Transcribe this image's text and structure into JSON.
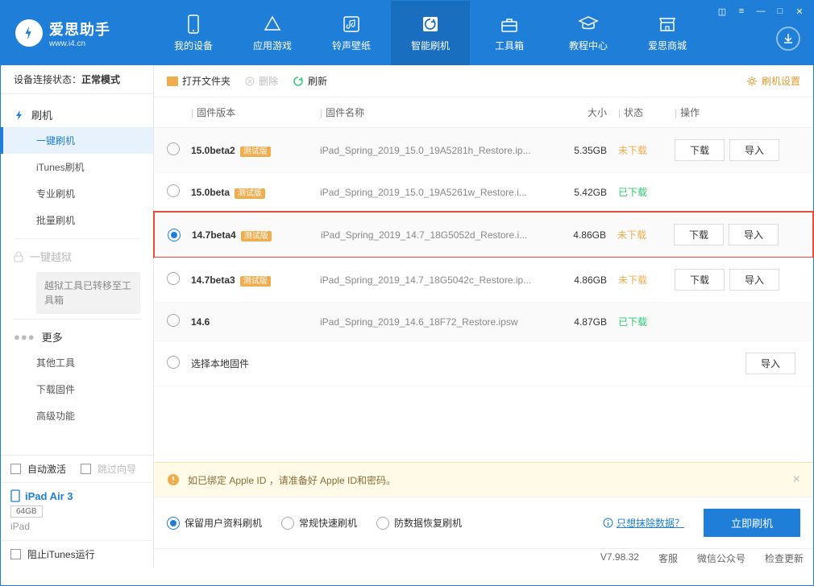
{
  "brand": {
    "title": "爱思助手",
    "subtitle": "www.i4.cn"
  },
  "nav": [
    "我的设备",
    "应用游戏",
    "铃声壁纸",
    "智能刷机",
    "工具箱",
    "教程中心",
    "爱思商城"
  ],
  "connection": {
    "label": "设备连接状态：",
    "value": "正常模式"
  },
  "sidebar": {
    "flash_group": "刷机",
    "flash_items": [
      "一键刷机",
      "iTunes刷机",
      "专业刷机",
      "批量刷机"
    ],
    "jailbreak_group": "一键越狱",
    "jailbreak_note": "越狱工具已转移至工具箱",
    "more_group": "更多",
    "more_items": [
      "其他工具",
      "下载固件",
      "高级功能"
    ],
    "auto_activate": "自动激活",
    "skip_guide": "跳过向导",
    "device": {
      "name": "iPad Air 3",
      "storage": "64GB",
      "type": "iPad"
    },
    "block_itunes": "阻止iTunes运行"
  },
  "toolbar": {
    "open": "打开文件夹",
    "delete": "删除",
    "refresh": "刷新",
    "settings": "刷机设置"
  },
  "columns": {
    "version": "固件版本",
    "name": "固件名称",
    "size": "大小",
    "status": "状态",
    "ops": "操作"
  },
  "status_labels": {
    "not_downloaded": "未下载",
    "downloaded": "已下载"
  },
  "buttons": {
    "download": "下载",
    "import": "导入"
  },
  "firmware": [
    {
      "version": "15.0beta2",
      "beta": "测试版",
      "name": "iPad_Spring_2019_15.0_19A5281h_Restore.ip...",
      "size": "5.35GB",
      "status": "not_downloaded",
      "ops": [
        "download",
        "import"
      ],
      "selected": false,
      "alt": true
    },
    {
      "version": "15.0beta",
      "beta": "测试版",
      "name": "iPad_Spring_2019_15.0_19A5261w_Restore.i...",
      "size": "5.42GB",
      "status": "downloaded",
      "ops": [],
      "selected": false,
      "alt": false
    },
    {
      "version": "14.7beta4",
      "beta": "测试版",
      "name": "iPad_Spring_2019_14.7_18G5052d_Restore.i...",
      "size": "4.86GB",
      "status": "not_downloaded",
      "ops": [
        "download",
        "import"
      ],
      "selected": true,
      "alt": true,
      "highlight": true
    },
    {
      "version": "14.7beta3",
      "beta": "测试版",
      "name": "iPad_Spring_2019_14.7_18G5042c_Restore.ip...",
      "size": "4.86GB",
      "status": "not_downloaded",
      "ops": [
        "download",
        "import"
      ],
      "selected": false,
      "alt": false
    },
    {
      "version": "14.6",
      "beta": "",
      "name": "iPad_Spring_2019_14.6_18F72_Restore.ipsw",
      "size": "4.87GB",
      "status": "downloaded",
      "ops": [],
      "selected": false,
      "alt": true
    }
  ],
  "local_row": {
    "label": "选择本地固件"
  },
  "banner": "如已绑定 Apple ID ，请准备好 Apple ID和密码。",
  "flash_options": [
    "保留用户资料刷机",
    "常规快速刷机",
    "防数据恢复刷机"
  ],
  "erase_link": "只想抹除数据？",
  "flash_now": "立即刷机",
  "status": {
    "version": "V7.98.32",
    "service": "客服",
    "wechat": "微信公众号",
    "update": "检查更新"
  }
}
